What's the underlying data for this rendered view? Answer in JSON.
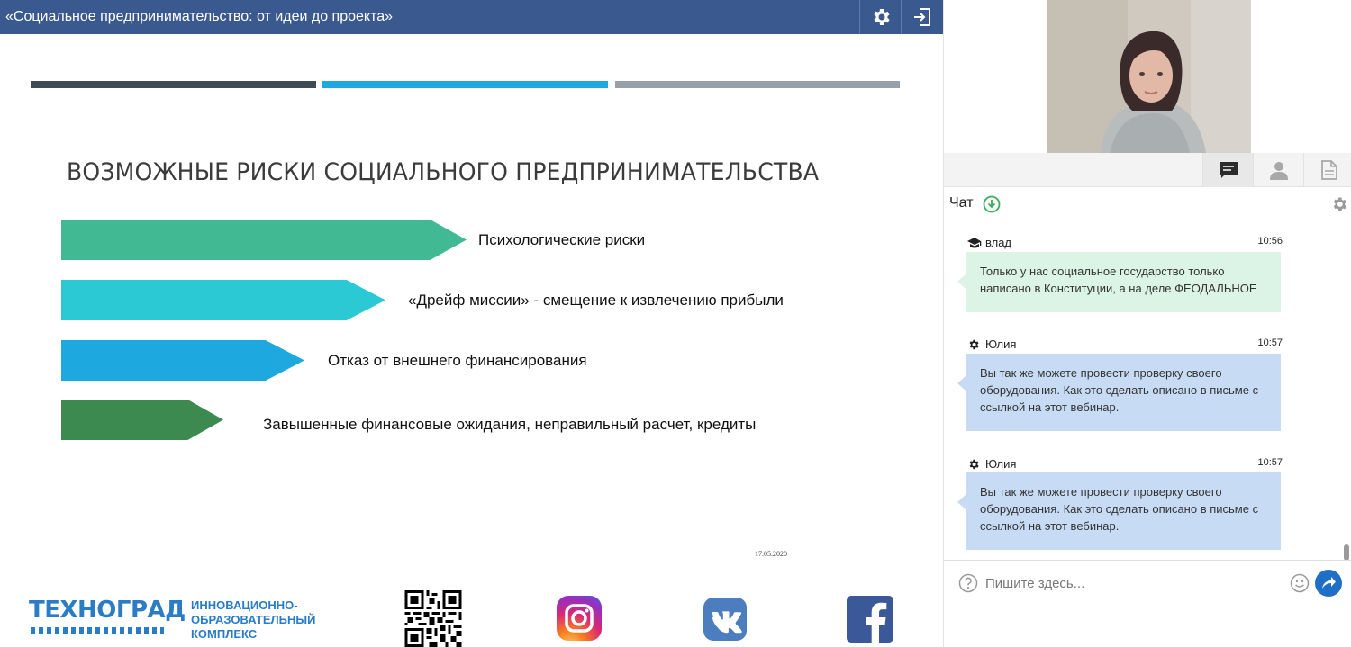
{
  "webinar": {
    "title": "«Социальное предпринимательство: от идеи до проекта»"
  },
  "toolbar": {
    "icons": [
      "gear-icon",
      "exit-icon"
    ]
  },
  "slide": {
    "heading": "ВОЗМОЖНЫЕ РИСКИ СОЦИАЛЬНОГО ПРЕДПРИНИМАТЕЛЬСТВА",
    "risks": [
      {
        "label": "Психологические риски",
        "color": "#41ba94"
      },
      {
        "label": "«Дрейф миссии» - смещение к извлечению прибыли",
        "color": "#2bc9d4"
      },
      {
        "label": "Отказ от внешнего финансирования",
        "color": "#1ea8e0"
      },
      {
        "label": "Завышенные финансовые ожидания, неправильный расчет,  кредиты",
        "color": "#3c8a50"
      }
    ],
    "date": "17.05.2020",
    "footer": {
      "brand": "ТЕХНОГРАД",
      "subtitle_lines": [
        "ИННОВАЦИОННО-",
        "ОБРАЗОВАТЕЛЬНЫЙ",
        "КОМПЛЕКС"
      ],
      "icons": [
        "qr-code",
        "instagram-icon",
        "vk-icon",
        "facebook-icon"
      ]
    },
    "accent_colors": {
      "bar_dark": "#3f4a55",
      "bar_blue": "#1ea8e0",
      "bar_gray": "#97a0a8"
    }
  },
  "side_panel": {
    "tabs": [
      "chat-icon",
      "participants-icon",
      "files-icon"
    ],
    "chat": {
      "title": "Чат",
      "messages": [
        {
          "author": "влад",
          "role_icon": "graduation-cap-icon",
          "time": "10:56",
          "text": "Только у нас социальное государство только написано в Конституции, а на деле ФЕОДАЛЬНОЕ",
          "color": "#dcf4e5"
        },
        {
          "author": "Юлия",
          "role_icon": "gear-icon",
          "time": "10:57",
          "text": "Вы так же можете провести проверку своего оборудования. Как это сделать описано в письме с ссылкой на этот вебинар.",
          "color": "#c7dcf4"
        },
        {
          "author": "Юлия",
          "role_icon": "gear-icon",
          "time": "10:57",
          "text": "Вы так же можете провести проверку своего оборудования. Как это сделать описано в письме с ссылкой на этот вебинар.",
          "color": "#c7dcf4"
        }
      ],
      "input_placeholder": "Пишите здесь..."
    }
  }
}
